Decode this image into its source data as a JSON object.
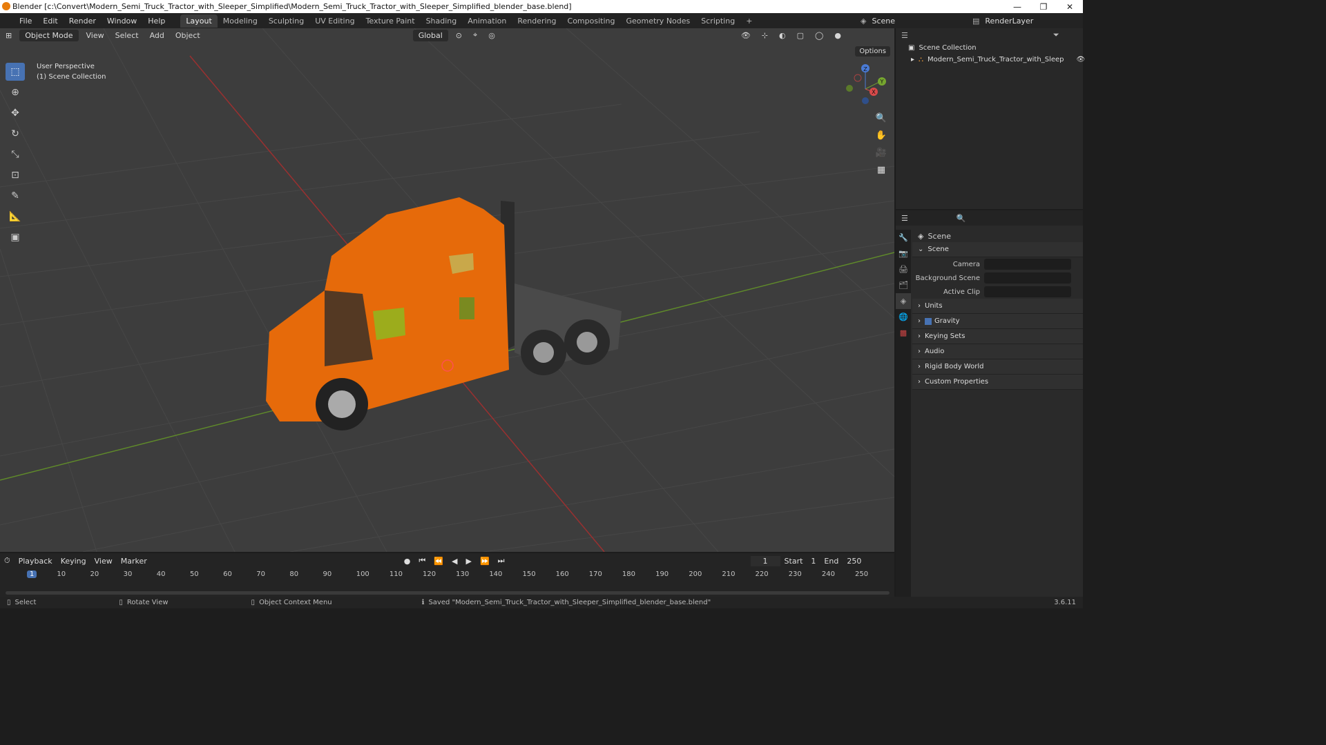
{
  "window": {
    "title": "Blender [c:\\Convert\\Modern_Semi_Truck_Tractor_with_Sleeper_Simplified\\Modern_Semi_Truck_Tractor_with_Sleeper_Simplified_blender_base.blend]",
    "controls": [
      "—",
      "❐",
      "✕"
    ]
  },
  "menu": [
    "File",
    "Edit",
    "Render",
    "Window",
    "Help"
  ],
  "workspaces": [
    {
      "label": "Layout",
      "active": true
    },
    {
      "label": "Modeling"
    },
    {
      "label": "Sculpting"
    },
    {
      "label": "UV Editing"
    },
    {
      "label": "Texture Paint"
    },
    {
      "label": "Shading"
    },
    {
      "label": "Animation"
    },
    {
      "label": "Rendering"
    },
    {
      "label": "Compositing"
    },
    {
      "label": "Geometry Nodes"
    },
    {
      "label": "Scripting"
    }
  ],
  "top_right": {
    "scene": "Scene",
    "view_layer": "RenderLayer"
  },
  "viewport": {
    "mode": "Object Mode",
    "menus": [
      "View",
      "Select",
      "Add",
      "Object"
    ],
    "transform": "Global",
    "options_label": "Options",
    "overlay_line1": "User Perspective",
    "overlay_line2": "(1) Scene Collection",
    "gizmo_labels": [
      "Z",
      "Y",
      "X"
    ]
  },
  "outliner": {
    "root": "Scene Collection",
    "item": "Modern_Semi_Truck_Tractor_with_Sleep"
  },
  "properties": {
    "header": "Scene",
    "panel_scene": "Scene",
    "camera_label": "Camera",
    "bg_scene_label": "Background Scene",
    "active_clip_label": "Active Clip",
    "panels": [
      "Units",
      "Gravity",
      "Keying Sets",
      "Audio",
      "Rigid Body World",
      "Custom Properties"
    ]
  },
  "timeline": {
    "menus": [
      "Playback",
      "Keying",
      "View",
      "Marker"
    ],
    "current_frame": "1",
    "start_label": "Start",
    "start": "1",
    "end_label": "End",
    "end": "250",
    "ticks": [
      "1",
      "10",
      "20",
      "30",
      "40",
      "50",
      "60",
      "70",
      "80",
      "90",
      "100",
      "110",
      "120",
      "130",
      "140",
      "150",
      "160",
      "170",
      "180",
      "190",
      "200",
      "210",
      "220",
      "230",
      "240",
      "250"
    ]
  },
  "status": {
    "select": "Select",
    "rotate": "Rotate View",
    "context": "Object Context Menu",
    "message": "Saved \"Modern_Semi_Truck_Tractor_with_Sleeper_Simplified_blender_base.blend\"",
    "version": "3.6.11"
  }
}
